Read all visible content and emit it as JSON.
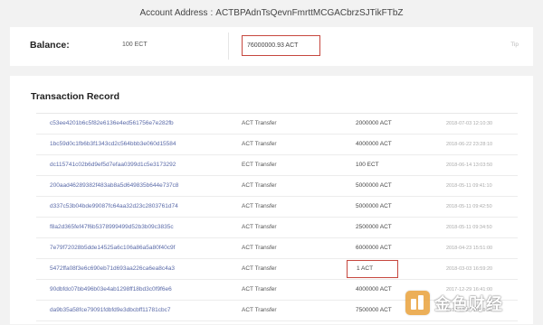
{
  "account": {
    "label": "Account Address",
    "separator": ":",
    "address": "ACTBPAdnTsQevnFmrttMCGACbrzSJTikFTbZ"
  },
  "balance": {
    "label": "Balance:",
    "ect_value": "100 ECT",
    "act_value": "76000000.93 ACT",
    "tip": "Tip"
  },
  "transactions": {
    "title": "Transaction Record",
    "rows": [
      {
        "hash": "c53ee4201b6c5f82e6136e4ed561756e7e282fb",
        "type": "ACT Transfer",
        "amount": "2000000 ACT",
        "date": "2018-07-03 12:10:30",
        "highlight": false
      },
      {
        "hash": "1bc59d0c1fb6b3f1343cd2c564bbb3e060d15584",
        "type": "ACT Transfer",
        "amount": "4000000 ACT",
        "date": "2018-06-22 23:28:10",
        "highlight": false
      },
      {
        "hash": "dc115741c02b6d9ef5d7efaa0399d1c5e3173292",
        "type": "ECT Transfer",
        "amount": "100 ECT",
        "date": "2018-06-14 13:03:50",
        "highlight": false
      },
      {
        "hash": "200aad46289382f483ab8a5d649835b644e737c8",
        "type": "ACT Transfer",
        "amount": "5000000 ACT",
        "date": "2018-05-11 09:41:10",
        "highlight": false
      },
      {
        "hash": "d337c53b04bde99087fc64aa32d23c2803761d74",
        "type": "ACT Transfer",
        "amount": "5000000 ACT",
        "date": "2018-05-11 09:42:50",
        "highlight": false
      },
      {
        "hash": "f8a2d365fef47f6b5378999499d52b3b09c3835c",
        "type": "ACT Transfer",
        "amount": "2500000 ACT",
        "date": "2018-05-11 09:34:50",
        "highlight": false
      },
      {
        "hash": "7e79f72028b5dde14525a6c106a86a5a80f40c9f",
        "type": "ACT Transfer",
        "amount": "6000000 ACT",
        "date": "2018-04-23 15:51:00",
        "highlight": false
      },
      {
        "hash": "5472ffa08f3e6c690eb71d693aa226ca6ea8c4a3",
        "type": "ACT Transfer",
        "amount": "1 ACT",
        "date": "2018-03-03 16:59:20",
        "highlight": true
      },
      {
        "hash": "90dbfdc07bb496b03e4ab1298ff18bd3c0f9f6e6",
        "type": "ACT Transfer",
        "amount": "4000000 ACT",
        "date": "2017-12-29 16:41:00",
        "highlight": false
      },
      {
        "hash": "da9b35a58fce79091fdbfd9e3dbcbff11781cbc7",
        "type": "ACT Transfer",
        "amount": "7500000 ACT",
        "date": "2017-12-27 10:49:50",
        "highlight": false
      }
    ]
  },
  "watermark": {
    "text": "金色财经"
  },
  "colors": {
    "background": "#f2f2f2",
    "card": "#ffffff",
    "hash_link": "#5a6aa8",
    "highlight_border": "#c6473e",
    "watermark_logo": "#e9a23b"
  }
}
